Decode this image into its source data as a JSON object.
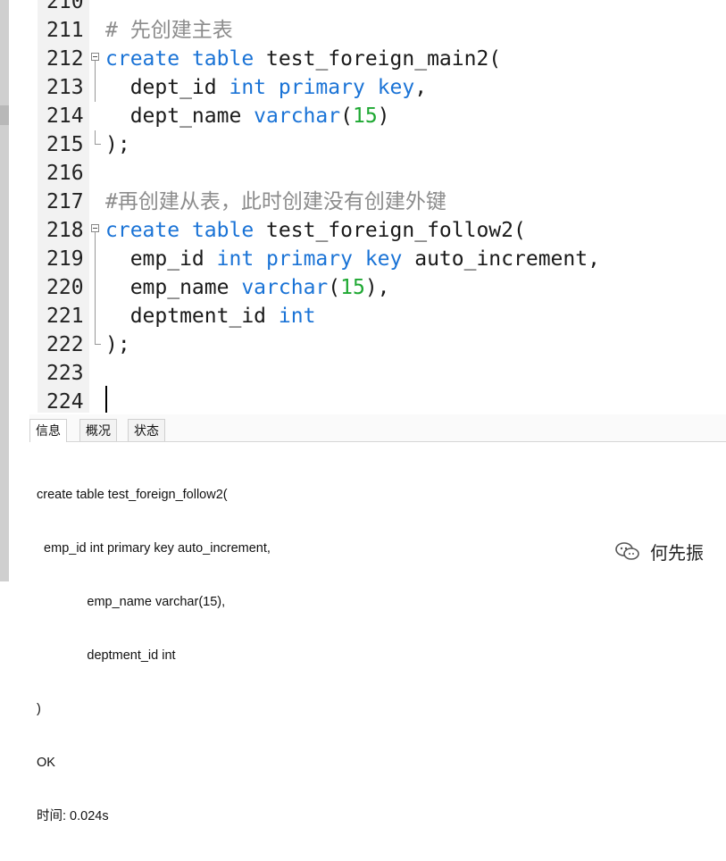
{
  "editor": {
    "lines": [
      {
        "no": "210",
        "segments": []
      },
      {
        "no": "211",
        "segments": [
          {
            "t": "# 先创建主表",
            "c": "cm"
          }
        ]
      },
      {
        "no": "212",
        "segments": [
          {
            "t": "create",
            "c": "kw"
          },
          {
            "t": " ",
            "c": ""
          },
          {
            "t": "table",
            "c": "kw"
          },
          {
            "t": " test_foreign_main2(",
            "c": ""
          }
        ]
      },
      {
        "no": "213",
        "segments": [
          {
            "t": "  dept_id ",
            "c": ""
          },
          {
            "t": "int",
            "c": "kw"
          },
          {
            "t": " ",
            "c": ""
          },
          {
            "t": "primary",
            "c": "kw"
          },
          {
            "t": " ",
            "c": ""
          },
          {
            "t": "key",
            "c": "kw"
          },
          {
            "t": ",",
            "c": ""
          }
        ]
      },
      {
        "no": "214",
        "segments": [
          {
            "t": "  dept_name ",
            "c": ""
          },
          {
            "t": "varchar",
            "c": "kw"
          },
          {
            "t": "(",
            "c": ""
          },
          {
            "t": "15",
            "c": "num"
          },
          {
            "t": ")",
            "c": ""
          }
        ]
      },
      {
        "no": "215",
        "segments": [
          {
            "t": ");",
            "c": ""
          }
        ]
      },
      {
        "no": "216",
        "segments": []
      },
      {
        "no": "217",
        "segments": [
          {
            "t": "#再创建从表，此时创建没有创建外键",
            "c": "cm"
          }
        ]
      },
      {
        "no": "218",
        "segments": [
          {
            "t": "create",
            "c": "kw"
          },
          {
            "t": " ",
            "c": ""
          },
          {
            "t": "table",
            "c": "kw"
          },
          {
            "t": " test_foreign_follow2(",
            "c": ""
          }
        ]
      },
      {
        "no": "219",
        "segments": [
          {
            "t": "  emp_id ",
            "c": ""
          },
          {
            "t": "int",
            "c": "kw"
          },
          {
            "t": " ",
            "c": ""
          },
          {
            "t": "primary",
            "c": "kw"
          },
          {
            "t": " ",
            "c": ""
          },
          {
            "t": "key",
            "c": "kw"
          },
          {
            "t": " auto_increment,",
            "c": ""
          }
        ]
      },
      {
        "no": "220",
        "segments": [
          {
            "t": "  emp_name ",
            "c": ""
          },
          {
            "t": "varchar",
            "c": "kw"
          },
          {
            "t": "(",
            "c": ""
          },
          {
            "t": "15",
            "c": "num"
          },
          {
            "t": "),",
            "c": ""
          }
        ]
      },
      {
        "no": "221",
        "segments": [
          {
            "t": "  deptment_id ",
            "c": ""
          },
          {
            "t": "int",
            "c": "kw"
          }
        ]
      },
      {
        "no": "222",
        "segments": [
          {
            "t": ");",
            "c": ""
          }
        ]
      },
      {
        "no": "223",
        "segments": []
      },
      {
        "no": "224",
        "segments": []
      }
    ]
  },
  "panel": {
    "tabs": [
      "信息",
      "概况",
      "状态"
    ],
    "active_tab": "信息",
    "message_lines": [
      "create table test_foreign_follow2(",
      "  emp_id int primary key auto_increment,",
      "              emp_name varchar(15),",
      "              deptment_id int",
      ")",
      "OK",
      "时间: 0.024s"
    ]
  },
  "watermark": {
    "text": "何先振",
    "icon": "wechat-icon"
  }
}
